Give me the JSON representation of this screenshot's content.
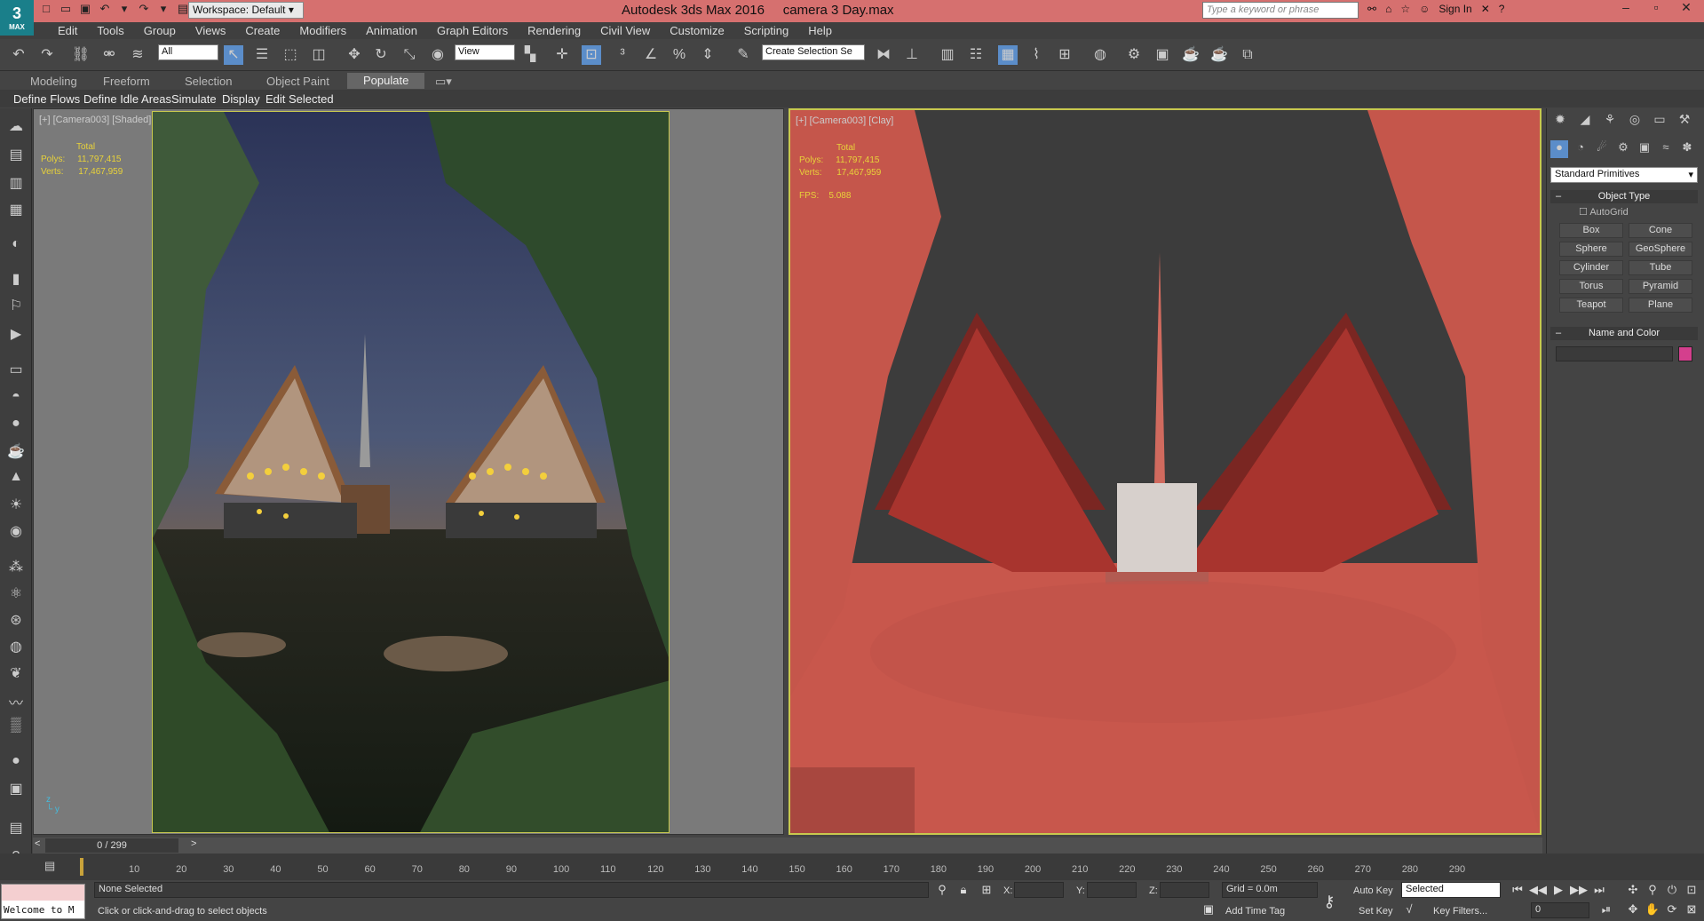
{
  "window": {
    "app_title": "Autodesk 3ds Max 2016",
    "file_title": "camera 3 Day.max",
    "logo": "3",
    "logo_sub": "MAX",
    "workspace": "Workspace: Default",
    "search_placeholder": "Type a keyword or phrase",
    "sign_in": "Sign In",
    "accent": "#d6706f"
  },
  "menu": [
    "Edit",
    "Tools",
    "Group",
    "Views",
    "Create",
    "Modifiers",
    "Animation",
    "Graph Editors",
    "Rendering",
    "Civil View",
    "Customize",
    "Scripting",
    "Help"
  ],
  "toolbar": {
    "filter": "All",
    "ref_coord": "View",
    "named_sel": "Create Selection Se"
  },
  "ribbon": {
    "tabs": [
      "Modeling",
      "Freeform",
      "Selection",
      "Object Paint",
      "Populate"
    ],
    "active": "Populate",
    "sub": [
      "Define Flows",
      "Define Idle Areas",
      "Simulate",
      "Display",
      "Edit Selected"
    ]
  },
  "viewport_left": {
    "label": "[+] [Camera003] [Shaded]",
    "stats_header": "Total",
    "polys_label": "Polys:",
    "polys": "11,797,415",
    "verts_label": "Verts:",
    "verts": "17,467,959"
  },
  "viewport_right": {
    "label": "[+] [Camera003] [Clay]",
    "stats_header": "Total",
    "polys_label": "Polys:",
    "polys": "11,797,415",
    "verts_label": "Verts:",
    "verts": "17,467,959",
    "fps_label": "FPS:",
    "fps": "5.088"
  },
  "command_panel": {
    "category": "Standard Primitives",
    "object_type": "Object Type",
    "autogrid": "AutoGrid",
    "buttons": [
      "Box",
      "Cone",
      "Sphere",
      "GeoSphere",
      "Cylinder",
      "Tube",
      "Torus",
      "Pyramid",
      "Teapot",
      "Plane"
    ],
    "name_color": "Name and Color",
    "swatch": "#d43f8d"
  },
  "timeline": {
    "frame": "0 / 299",
    "ticks": [
      "10",
      "20",
      "30",
      "40",
      "50",
      "60",
      "70",
      "80",
      "90",
      "100",
      "110",
      "120",
      "130",
      "140",
      "150",
      "160",
      "170",
      "180",
      "190",
      "200",
      "210",
      "220",
      "230",
      "240",
      "250",
      "260",
      "270",
      "280",
      "290"
    ]
  },
  "status": {
    "welcome": "Welcome to M",
    "selection": "None Selected",
    "prompt": "Click or click-and-drag to select objects",
    "x_label": "X:",
    "y_label": "Y:",
    "z_label": "Z:",
    "grid": "Grid = 0.0m",
    "add_time_tag": "Add Time Tag",
    "auto_key": "Auto Key",
    "auto_key_sel": "Selected",
    "set_key": "Set Key",
    "key_filters": "Key Filters...",
    "frame_field": "0"
  }
}
